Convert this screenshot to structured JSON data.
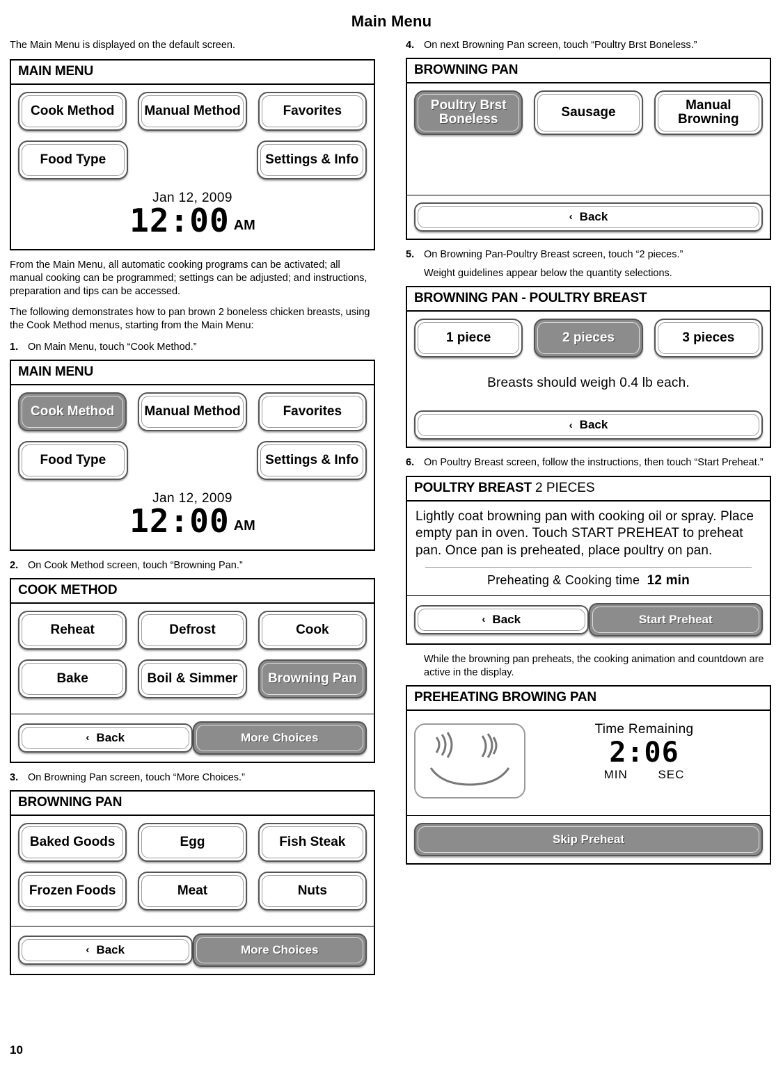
{
  "header": {
    "title": "Main Menu"
  },
  "folio": "10",
  "left": {
    "intro": "The Main Menu is displayed on the default screen.",
    "panel1": {
      "title": "MAIN MENU",
      "buttons": [
        "Cook Method",
        "Manual Method",
        "Favorites",
        "Food Type",
        "Settings & Info"
      ],
      "date": "Jan 12, 2009",
      "time": "12:00",
      "ampm": "AM"
    },
    "para1": "From the Main Menu, all automatic cooking programs can be activated; all manual cooking can be programmed; settings can be adjusted; and instructions, preparation and tips can be accessed.",
    "para2": "The following demonstrates how to pan brown 2 boneless chicken breasts, using the Cook Method menus, starting from the Main Menu:",
    "step1": {
      "num": "1.",
      "text": "On Main Menu, touch “Cook Method.”"
    },
    "panel2": {
      "title": "MAIN MENU",
      "buttons": [
        "Cook Method",
        "Manual Method",
        "Favorites",
        "Food Type",
        "Settings & Info"
      ],
      "selected": "Cook Method",
      "date": "Jan 12, 2009",
      "time": "12:00",
      "ampm": "AM"
    },
    "step2": {
      "num": "2.",
      "text": "On Cook Method screen, touch “Browning Pan.”"
    },
    "panel3": {
      "title": "COOK METHOD",
      "row1": [
        "Reheat",
        "Defrost",
        "Cook"
      ],
      "row2": [
        "Bake",
        "Boil & Simmer",
        "Browning Pan"
      ],
      "selected": "Browning Pan",
      "back": "Back",
      "more": "More Choices"
    },
    "step3": {
      "num": "3.",
      "text": "On Browning Pan screen, touch “More Choices.”"
    },
    "panel4": {
      "title": "BROWNING PAN",
      "row1": [
        "Baked Goods",
        "Egg",
        "Fish Steak"
      ],
      "row2": [
        "Frozen Foods",
        "Meat",
        "Nuts"
      ],
      "back": "Back",
      "more": "More Choices",
      "more_selected": true
    }
  },
  "right": {
    "step4": {
      "num": "4.",
      "text": "On next Browning Pan screen, touch “Poultry Brst Boneless.”"
    },
    "panel5": {
      "title": "BROWNING PAN",
      "row1": [
        "Poultry Brst Boneless",
        "Sausage",
        "Manual Browning"
      ],
      "selected": "Poultry Brst Boneless",
      "back": "Back"
    },
    "step5": {
      "num": "5.",
      "text": "On Browning Pan-Poultry Breast screen, touch “2 pieces.”"
    },
    "step5note": "Weight guidelines appear below the quantity selections.",
    "panel6": {
      "title": "BROWNING PAN - POULTRY BREAST",
      "row1": [
        "1 piece",
        "2 pieces",
        "3 pieces"
      ],
      "selected": "2 pieces",
      "note": "Breasts should weigh 0.4 lb each.",
      "back": "Back"
    },
    "step6": {
      "num": "6.",
      "text": "On Poultry Breast screen, follow the instructions, then touch “Start Preheat.”"
    },
    "panel7": {
      "title_bold": "POULTRY BREAST",
      "title_light": "2 PIECES",
      "instructions": "Lightly coat browning pan with cooking oil or spray. Place empty pan in oven. Touch START PREHEAT to preheat pan. Once pan is preheated, place poultry on pan.",
      "preheat_label": "Preheating & Cooking time",
      "preheat_value": "12 min",
      "back": "Back",
      "start": "Start Preheat"
    },
    "step6note": "While the browning pan preheats, the cooking animation and countdown are active in the display.",
    "panel8": {
      "title": "PREHEATING BROWING PAN",
      "time_label": "Time Remaining",
      "time": "2:06",
      "unit_min": "MIN",
      "unit_sec": "SEC",
      "skip": "Skip Preheat"
    }
  }
}
